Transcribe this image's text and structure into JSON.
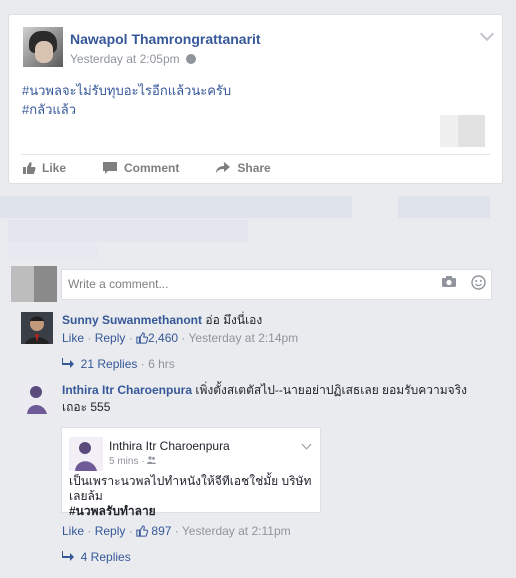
{
  "post": {
    "author": "Nawapol Thamrongrattanarit",
    "time": "Yesterday at 2:05pm",
    "line1": "#นวพลจะไม่รับทุบอะไรอีกแล้วนะครับ",
    "line2": "#กลัวแล้ว"
  },
  "actions": {
    "like": "Like",
    "comment": "Comment",
    "share": "Share"
  },
  "comment_box": {
    "placeholder": "Write a comment..."
  },
  "comments": [
    {
      "name": "Sunny Suwanmethanont",
      "text": "อ่อ มึงนี่เอง",
      "like": "Like",
      "reply": "Reply",
      "likes": "2,460",
      "time": "Yesterday at 2:14pm",
      "replies": "21 Replies",
      "replies_ago": "6 hrs"
    },
    {
      "name": "Inthira Itr Charoenpura",
      "text": "เพิ่งตั้งสเตตัสไป--นายอย่าปฏิเสธเลย ยอมรับความจริงเถอะ 555",
      "shared": {
        "name": "Inthira Itr Charoenpura",
        "time": "5 mins",
        "text": "เป็นเพราะนวพลไปทำหนังให้จีทีเอชใช่มั้ย บริษัทเลยล้ม",
        "tag": "#นวพลรับทำลาย"
      },
      "like": "Like",
      "reply": "Reply",
      "likes": "897",
      "time": "Yesterday at 2:11pm",
      "replies": "4 Replies"
    }
  ],
  "colors": {
    "link": "#365899",
    "muted": "#90949c",
    "background": "#e9ebee"
  }
}
